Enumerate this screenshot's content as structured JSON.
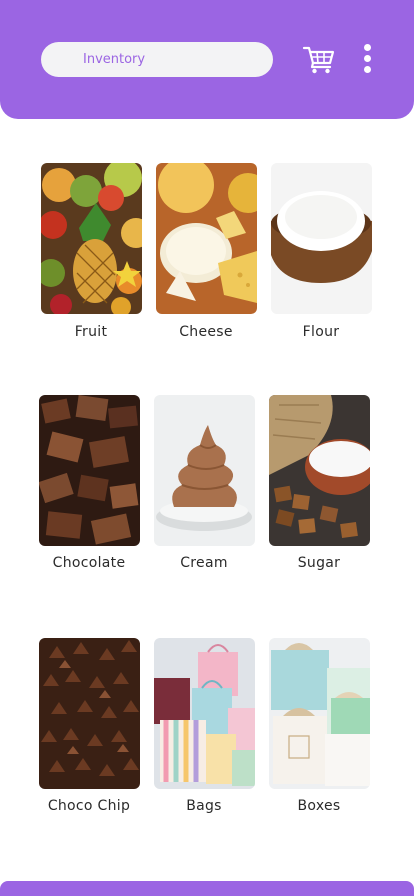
{
  "header": {
    "search_label": "Inventory",
    "accent_color": "#9b65e3",
    "cart_icon": "cart-icon",
    "menu_icon": "kebab-menu-icon"
  },
  "categories": [
    {
      "label": "Fruit",
      "image": "fruit-photo"
    },
    {
      "label": "Cheese",
      "image": "cheese-photo"
    },
    {
      "label": "Flour",
      "image": "flour-photo"
    },
    {
      "label": "Chocolate",
      "image": "chocolate-photo"
    },
    {
      "label": "Cream",
      "image": "cream-photo"
    },
    {
      "label": "Sugar",
      "image": "sugar-photo"
    },
    {
      "label": "Choco Chip",
      "image": "choco-chip-photo"
    },
    {
      "label": "Bags",
      "image": "bags-photo"
    },
    {
      "label": "Boxes",
      "image": "boxes-photo"
    }
  ]
}
